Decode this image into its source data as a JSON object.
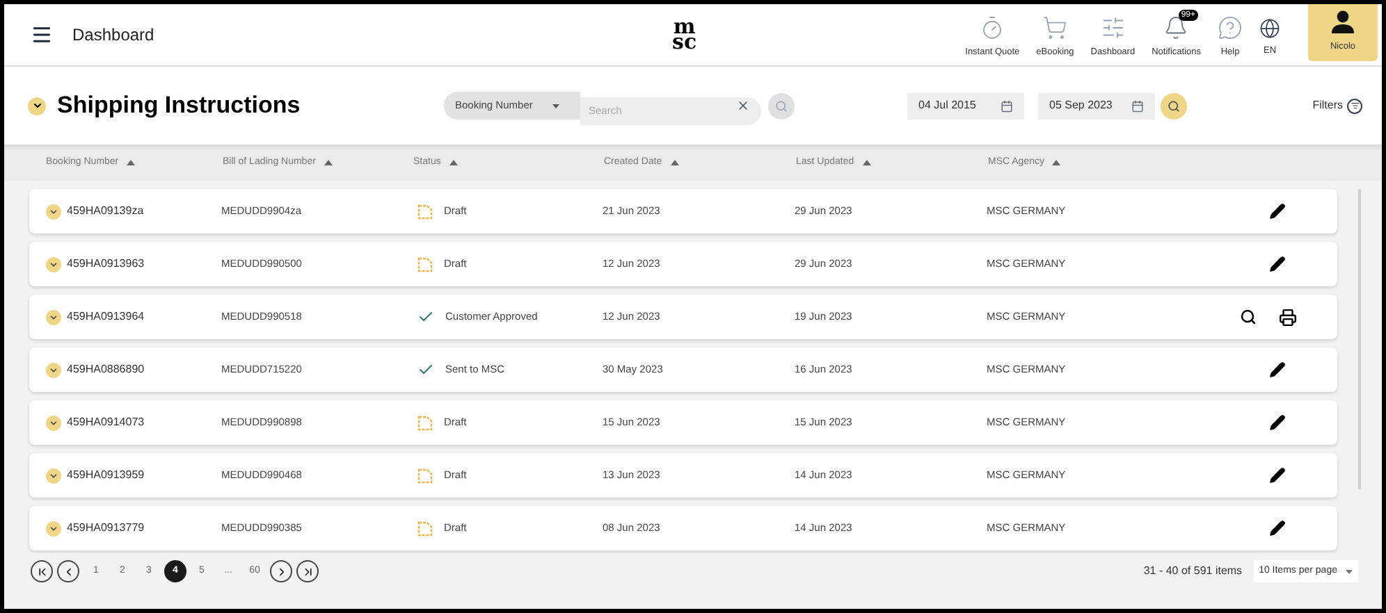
{
  "header": {
    "title": "Dashboard",
    "logo": [
      "m",
      "sc"
    ],
    "nav": [
      {
        "kind": "quote",
        "label": "Instant Quote"
      },
      {
        "kind": "booking",
        "label": "eBooking"
      },
      {
        "kind": "dashboard",
        "label": "Dashboard"
      },
      {
        "kind": "notifications",
        "label": "Notifications",
        "badge": "99+"
      },
      {
        "kind": "help",
        "label": "Help"
      },
      {
        "kind": "language",
        "label": "EN"
      }
    ],
    "user": {
      "name": "Nicolo"
    }
  },
  "toolbar": {
    "title": "Shipping Instructions",
    "search_by": "Booking Number",
    "search": {
      "placeholder": "Search"
    },
    "date_from": "04 Jul 2015",
    "date_to": "05 Sep 2023",
    "filters": "Filters"
  },
  "table": {
    "columns": [
      "Booking Number",
      "Bill of Lading Number",
      "Status",
      "Created Date",
      "Last Updated",
      "MSC Agency"
    ],
    "rows": [
      {
        "booking": "459HA09139za",
        "bl": "MEDUDD9904za",
        "status": {
          "kind": "draft",
          "text": "Draft"
        },
        "created": "21 Jun 2023",
        "updated": "29 Jun 2023",
        "agency": "MSC GERMANY",
        "actions": [
          {
            "kind": "edit"
          }
        ]
      },
      {
        "booking": "459HA0913963",
        "bl": "MEDUDD990500",
        "status": {
          "kind": "draft",
          "text": "Draft"
        },
        "created": "12 Jun 2023",
        "updated": "29 Jun 2023",
        "agency": "MSC GERMANY",
        "actions": [
          {
            "kind": "edit"
          }
        ]
      },
      {
        "booking": "459HA0913964",
        "bl": "MEDUDD990518",
        "status": {
          "kind": "done",
          "text": "Customer Approved"
        },
        "created": "12 Jun 2023",
        "updated": "19 Jun 2023",
        "agency": "MSC GERMANY",
        "actions": [
          {
            "kind": "view"
          },
          {
            "kind": "print"
          }
        ]
      },
      {
        "booking": "459HA0886890",
        "bl": "MEDUDD715220",
        "status": {
          "kind": "done",
          "text": "Sent to MSC"
        },
        "created": "30 May 2023",
        "updated": "16 Jun 2023",
        "agency": "MSC GERMANY",
        "actions": [
          {
            "kind": "edit"
          }
        ]
      },
      {
        "booking": "459HA0914073",
        "bl": "MEDUDD990898",
        "status": {
          "kind": "draft",
          "text": "Draft"
        },
        "created": "15 Jun 2023",
        "updated": "15 Jun 2023",
        "agency": "MSC GERMANY",
        "actions": [
          {
            "kind": "edit"
          }
        ]
      },
      {
        "booking": "459HA0913959",
        "bl": "MEDUDD990468",
        "status": {
          "kind": "draft",
          "text": "Draft"
        },
        "created": "13 Jun 2023",
        "updated": "14 Jun 2023",
        "agency": "MSC GERMANY",
        "actions": [
          {
            "kind": "edit"
          }
        ]
      },
      {
        "booking": "459HA0913779",
        "bl": "MEDUDD990385",
        "status": {
          "kind": "draft",
          "text": "Draft"
        },
        "created": "08 Jun 2023",
        "updated": "14 Jun 2023",
        "agency": "MSC GERMANY",
        "actions": [
          {
            "kind": "edit"
          }
        ]
      }
    ]
  },
  "pagination": {
    "pages": [
      {
        "label": "1",
        "selected": false
      },
      {
        "label": "2",
        "selected": false
      },
      {
        "label": "3",
        "selected": false
      },
      {
        "label": "4",
        "selected": true
      },
      {
        "label": "5",
        "selected": false
      },
      {
        "label": "...",
        "selected": false
      },
      {
        "label": "60",
        "selected": false
      }
    ],
    "summary": "31 - 40 of 591 items",
    "page_size": "10 Items per page"
  }
}
